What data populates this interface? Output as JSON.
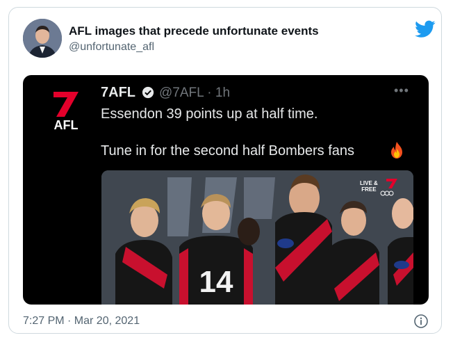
{
  "tweet": {
    "author_name": "AFL images that precede unfortunate events",
    "author_handle": "@unfortunate_afl",
    "timestamp": "7:27 PM · Mar 20, 2021"
  },
  "embedded": {
    "logo_text": "AFL",
    "name": "7AFL",
    "handle_time": "@7AFL · 1h",
    "line1": "Essendon 39 points up at half time.",
    "line2": "Tune in for the second half Bombers fans",
    "photo": {
      "badge_line1": "LIVE &",
      "badge_line2": "FREE",
      "jersey_number": "14"
    }
  },
  "colors": {
    "twitter_blue": "#1d9bf0",
    "seven_red": "#e4002b",
    "bombers_red": "#c8102e"
  },
  "icons": {
    "verified": "verified-badge-icon",
    "bird": "twitter-bird-icon",
    "info": "info-icon",
    "more": "more-dots-icon",
    "fire": "fire-emoji-icon"
  }
}
